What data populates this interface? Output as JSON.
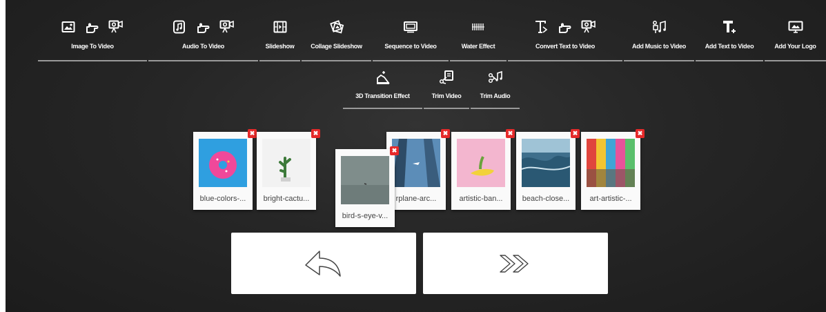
{
  "toolbar": {
    "items": [
      {
        "label": "Image To Video",
        "icons": [
          "image-icon",
          "hand-pointer-icon",
          "projector-icon"
        ]
      },
      {
        "label": "Audio To Video",
        "icons": [
          "audio-file-icon",
          "hand-pointer-icon",
          "projector-icon"
        ]
      },
      {
        "label": "Slideshow",
        "icons": [
          "film-strip-icon"
        ]
      },
      {
        "label": "Collage Slideshow",
        "icons": [
          "collage-icon"
        ]
      },
      {
        "label": "Sequence to Video",
        "icons": [
          "sequence-icon"
        ]
      },
      {
        "label": "Water Effect",
        "icons": [
          "water-effect-icon"
        ]
      },
      {
        "label": "Convert Text to Video",
        "icons": [
          "text-icon",
          "hand-pointer-icon",
          "projector-icon"
        ]
      },
      {
        "label": "Add Music to Video",
        "icons": [
          "music-video-icon"
        ]
      },
      {
        "label": "Add Text to Video",
        "icons": [
          "add-text-icon"
        ]
      },
      {
        "label": "Add Your Logo",
        "icons": [
          "logo-icon"
        ]
      }
    ],
    "second_row": [
      {
        "label": "3D Transition Effect",
        "icons": [
          "transition-3d-icon"
        ]
      },
      {
        "label": "Trim Video",
        "icons": [
          "trim-video-icon"
        ]
      },
      {
        "label": "Trim Audio",
        "icons": [
          "trim-audio-icon"
        ]
      }
    ]
  },
  "images": [
    {
      "name": "blue-colors-...",
      "color": "#2f9fe0"
    },
    {
      "name": "bright-cactu...",
      "color": "#f2f2f2"
    },
    {
      "name": "rplane-arc...",
      "color": "#5c8db8"
    },
    {
      "name": "artistic-ban...",
      "color": "#f3b6cf"
    },
    {
      "name": "beach-close...",
      "color": "#3f6f8c"
    },
    {
      "name": "art-artistic-...",
      "color": "#4fa47a"
    }
  ],
  "dragging_image": {
    "name": "bird-s-eye-v...",
    "color": "#8a9896"
  },
  "delete_glyph": "✖",
  "nav": {
    "back": "back-arrow-icon",
    "next": "double-chevron-right-icon"
  },
  "colors": {
    "background": "#262626",
    "delete": "#e62a2a"
  }
}
